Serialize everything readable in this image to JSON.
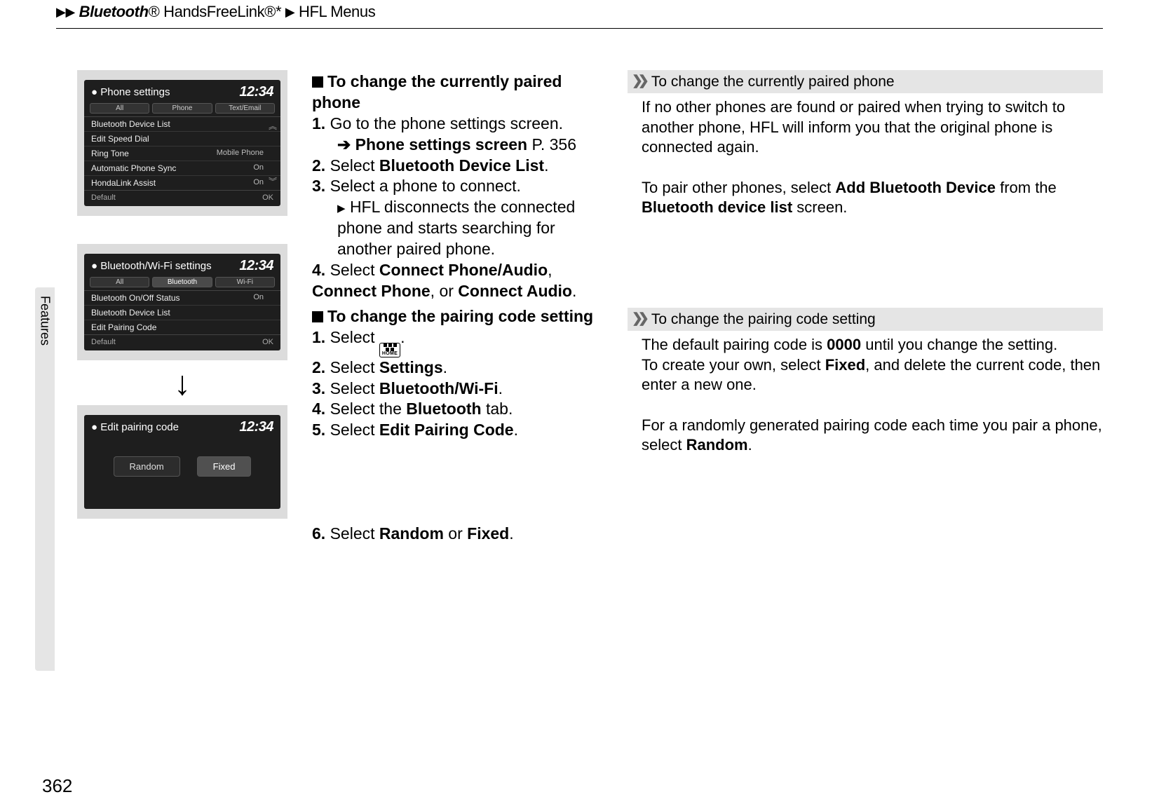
{
  "breadcrumb": {
    "item1_italic": "Bluetooth",
    "item1_reg": "®",
    "item1_rest": " HandsFreeLink®*",
    "item2": "HFL Menus"
  },
  "sidetab": "Features",
  "page_number": "362",
  "screens": {
    "s1": {
      "title": "Phone settings",
      "time": "12:34",
      "tabs": [
        "All",
        "Phone",
        "Text/Email"
      ],
      "rows": [
        {
          "label": "Bluetooth Device List",
          "val": ""
        },
        {
          "label": "Edit Speed Dial",
          "val": ""
        },
        {
          "label": "Ring Tone",
          "val": "Mobile Phone"
        },
        {
          "label": "Automatic Phone Sync",
          "val": "On"
        },
        {
          "label": "HondaLink Assist",
          "val": "On"
        }
      ],
      "footer_left": "Default",
      "footer_right": "OK"
    },
    "s2": {
      "title": "Bluetooth/Wi-Fi settings",
      "time": "12:34",
      "tabs": [
        "All",
        "Bluetooth",
        "Wi-Fi"
      ],
      "selected_tab": 1,
      "rows": [
        {
          "label": "Bluetooth On/Off Status",
          "val": "On"
        },
        {
          "label": "Bluetooth Device List",
          "val": ""
        },
        {
          "label": "Edit Pairing Code",
          "val": ""
        }
      ],
      "footer_left": "Default",
      "footer_right": "OK"
    },
    "s3": {
      "title": "Edit pairing code",
      "time": "12:34",
      "buttons": [
        "Random",
        "Fixed"
      ],
      "selected_btn": 1
    }
  },
  "instr": {
    "h1": "To change the currently paired phone",
    "s1_1": "Go to the phone settings screen.",
    "s1_xref": "Phone settings screen",
    "s1_xref_p": "P. 356",
    "s1_2a": "Select ",
    "s1_2b": "Bluetooth Device List",
    "s1_3": "Select a phone to connect.",
    "s1_3sub": "HFL disconnects the connected phone and starts searching for another paired phone.",
    "s1_4a": "Select ",
    "s1_4b": "Connect Phone/Audio",
    "s1_4c": "Connect Phone",
    "s1_4d": "Connect Audio",
    "h2": "To change the pairing code setting",
    "s2_1a": "Select ",
    "home_label": "HOME",
    "s2_2a": "Select ",
    "s2_2b": "Settings",
    "s2_3a": "Select ",
    "s2_3b": "Bluetooth/Wi-Fi",
    "s2_4a": "Select the ",
    "s2_4b": "Bluetooth",
    "s2_4c": " tab.",
    "s2_5a": "Select ",
    "s2_5b": "Edit Pairing Code",
    "s2_6a": "Select ",
    "s2_6b": "Random",
    "s2_6c": " or ",
    "s2_6d": "Fixed"
  },
  "notes": {
    "n1_head": "To change the currently paired phone",
    "n1_p1": "If no other phones are found or paired when trying to switch to another phone, HFL will inform you that the original phone is connected again.",
    "n1_p2a": "To pair other phones, select ",
    "n1_p2b": "Add Bluetooth Device",
    "n1_p2c": " from the ",
    "n1_p2d": "Bluetooth device list",
    "n1_p2e": " screen.",
    "n2_head": "To change the pairing code setting",
    "n2_p1a": "The default pairing code is ",
    "n2_p1b": "0000",
    "n2_p1c": " until you change the setting.",
    "n2_p2a": "To create your own, select ",
    "n2_p2b": "Fixed",
    "n2_p2c": ", and delete the current code, then enter a new one.",
    "n2_p3a": "For a randomly generated pairing code each time you pair a phone, select ",
    "n2_p3b": "Random",
    "n2_p3c": "."
  }
}
